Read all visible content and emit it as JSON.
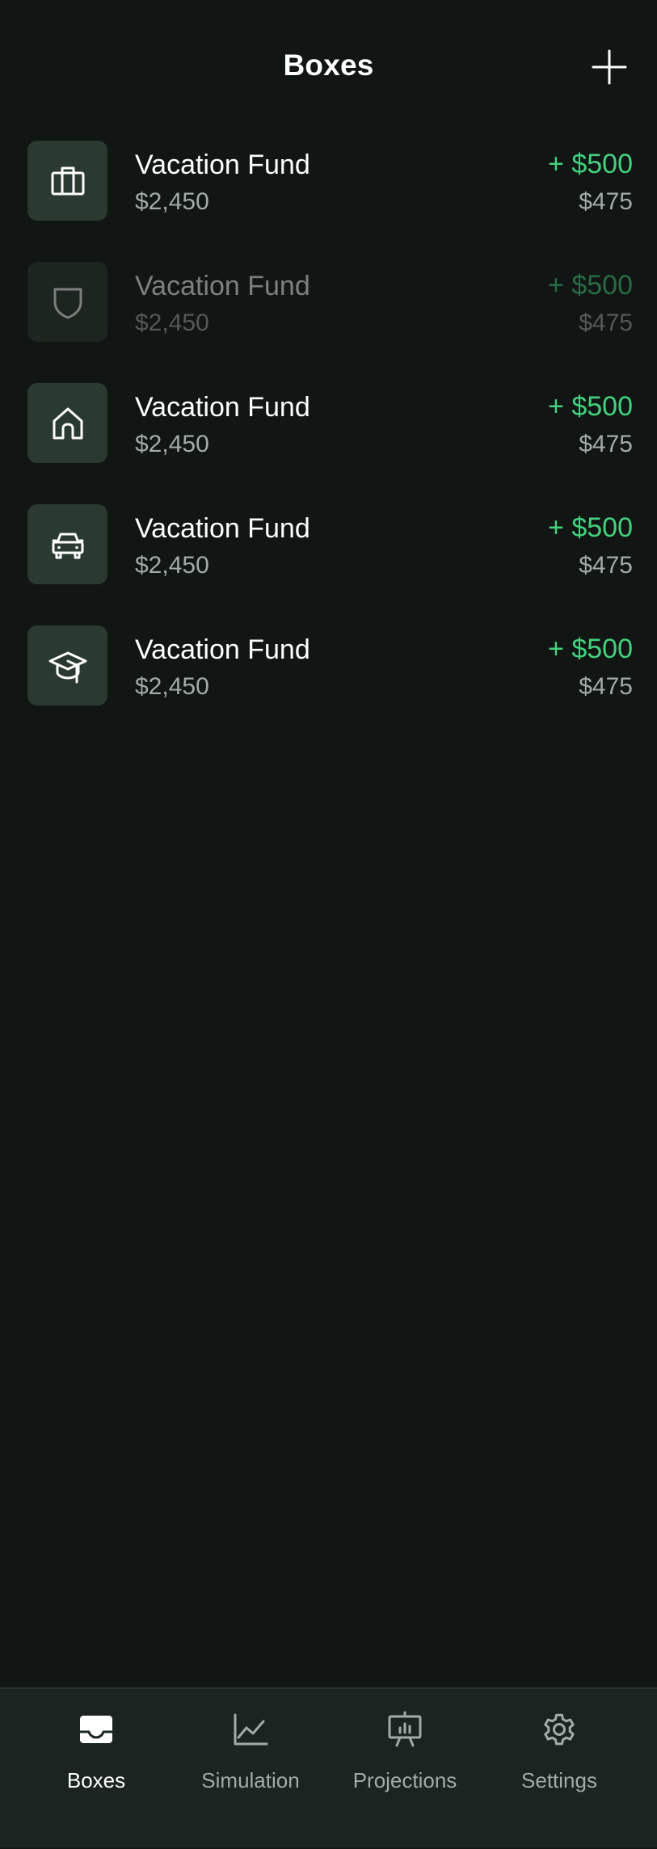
{
  "header": {
    "title": "Boxes",
    "add_icon": "plus-icon"
  },
  "colors": {
    "background": "#111514",
    "tile": "#2a3a30",
    "accent_green": "#43d17c",
    "muted_text": "#a3aba6",
    "tab_bar": "#1b2420"
  },
  "boxes": [
    {
      "icon": "briefcase-icon",
      "name": "Vacation Fund",
      "balance": "$2,450",
      "deposit": "+ $500",
      "monthly": "$475",
      "muted": false
    },
    {
      "icon": "shield-icon",
      "name": "Vacation Fund",
      "balance": "$2,450",
      "deposit": "+ $500",
      "monthly": "$475",
      "muted": true
    },
    {
      "icon": "home-icon",
      "name": "Vacation Fund",
      "balance": "$2,450",
      "deposit": "+ $500",
      "monthly": "$475",
      "muted": false
    },
    {
      "icon": "car-icon",
      "name": "Vacation Fund",
      "balance": "$2,450",
      "deposit": "+ $500",
      "monthly": "$475",
      "muted": false
    },
    {
      "icon": "graduation-cap-icon",
      "name": "Vacation Fund",
      "balance": "$2,450",
      "deposit": "+ $500",
      "monthly": "$475",
      "muted": false
    }
  ],
  "tabs": [
    {
      "icon": "inbox-icon",
      "label": "Boxes",
      "active": true
    },
    {
      "icon": "line-chart-icon",
      "label": "Simulation",
      "active": false
    },
    {
      "icon": "presentation-chart-icon",
      "label": "Projections",
      "active": false
    },
    {
      "icon": "gear-icon",
      "label": "Settings",
      "active": false
    }
  ]
}
